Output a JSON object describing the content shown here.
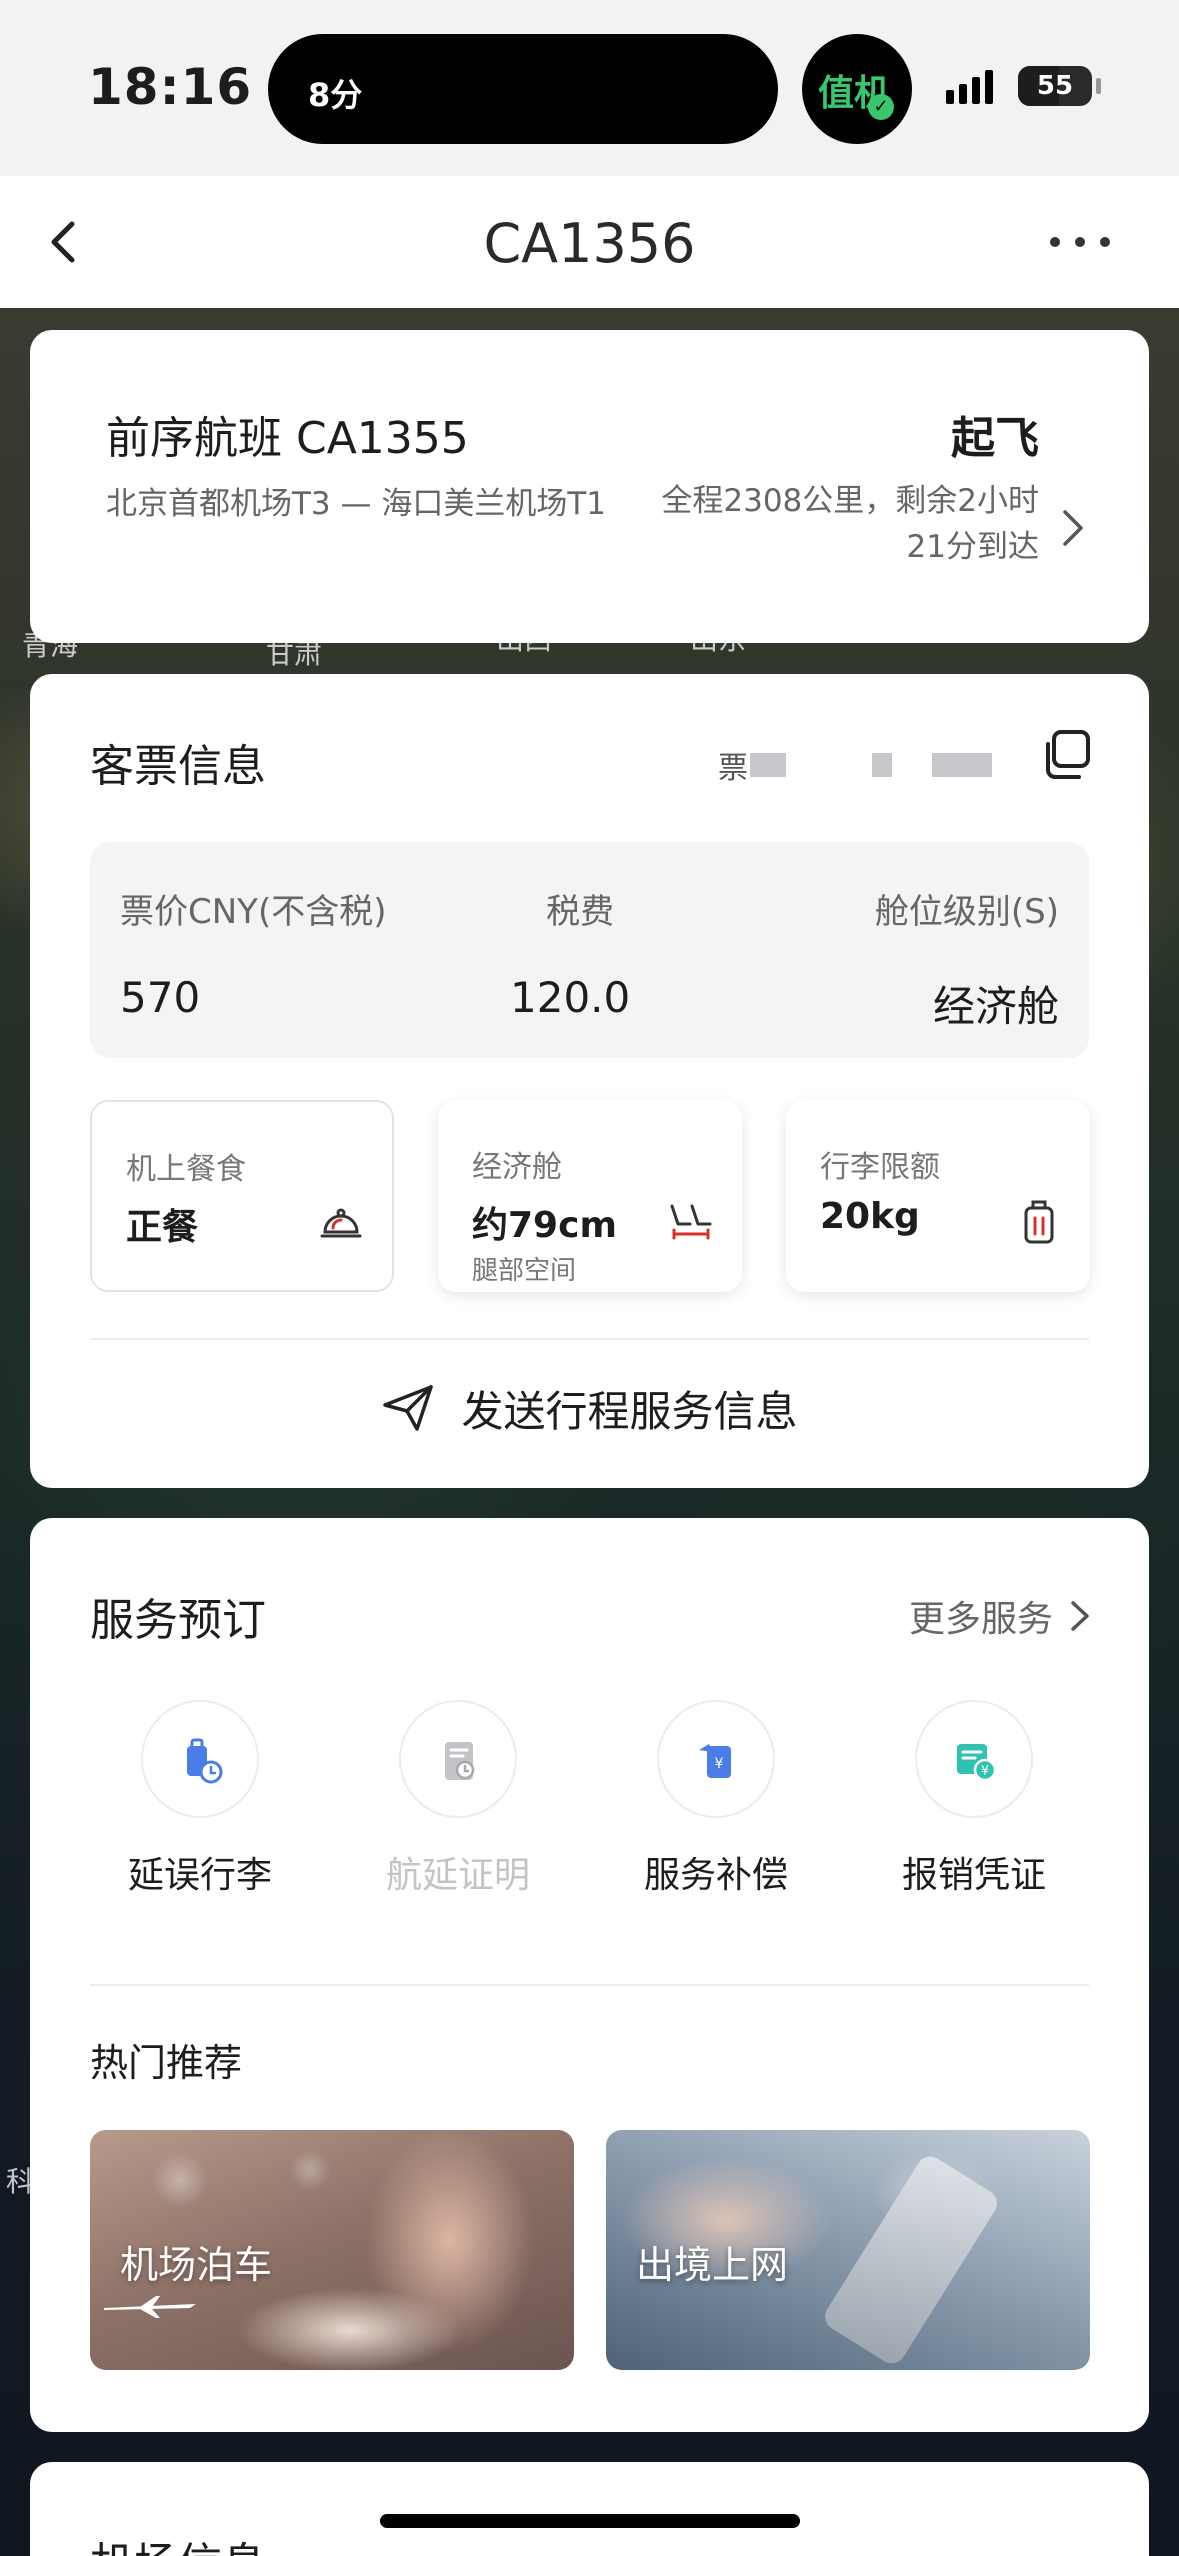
{
  "status_bar": {
    "time": "18:16",
    "island_text": "8分",
    "checkin_text": "值机",
    "battery_text": "55"
  },
  "nav": {
    "title": "CA1356"
  },
  "map_labels": [
    "青海",
    "甘肃",
    "山西",
    "山东",
    "科"
  ],
  "previous_flight": {
    "title": "前序航班 CA1355",
    "status": "起飞",
    "route": "北京首都机场T3 — 海口美兰机场T1",
    "remaining": "全程2308公里，剩余2小时21分到达"
  },
  "ticket": {
    "title": "客票信息",
    "ticket_no_label": "票",
    "fare": [
      {
        "label": "票价CNY(不含税)",
        "value": "570"
      },
      {
        "label": "税费",
        "value": "120.0"
      },
      {
        "label": "舱位级别(S)",
        "value": "经济舱"
      }
    ],
    "tiles": [
      {
        "label": "机上餐食",
        "value": "正餐",
        "sub": "",
        "icon": "meal-cloche-icon"
      },
      {
        "label": "经济舱",
        "value": "约79cm",
        "sub": "腿部空间",
        "icon": "seat-legroom-icon"
      },
      {
        "label": "行李限额",
        "value": "20kg",
        "sub": "",
        "icon": "luggage-icon"
      }
    ],
    "send_label": "发送行程服务信息"
  },
  "services": {
    "title": "服务预订",
    "more_label": "更多服务",
    "items": [
      {
        "label": "延误行李",
        "icon": "delayed-luggage-icon",
        "enabled": true
      },
      {
        "label": "航延证明",
        "icon": "delay-certificate-icon",
        "enabled": false
      },
      {
        "label": "服务补偿",
        "icon": "compensation-icon",
        "enabled": true
      },
      {
        "label": "报销凭证",
        "icon": "reimbursement-receipt-icon",
        "enabled": true
      }
    ],
    "hot_title": "热门推荐",
    "promos": [
      {
        "label": "机场泊车"
      },
      {
        "label": "出境上网"
      }
    ]
  },
  "airport": {
    "title": "机场信息"
  },
  "colors": {
    "accent_green": "#39c66e",
    "svc_blue": "#4a7de8",
    "svc_teal": "#2fc2b0",
    "red_accent": "#d9302b"
  }
}
